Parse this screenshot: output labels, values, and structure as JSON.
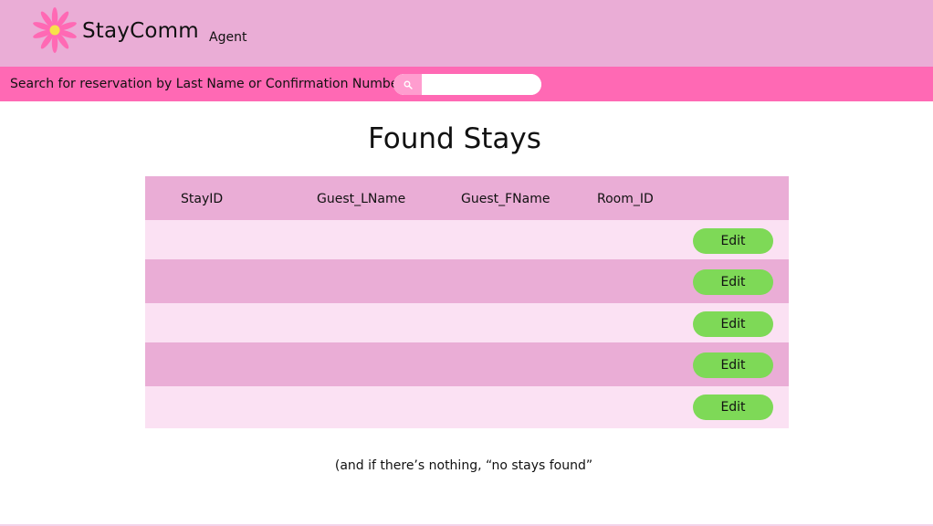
{
  "header": {
    "brand": "StayComm",
    "role": "Agent",
    "logo_icon": "pink-daisy-icon",
    "background": "#eaadd6"
  },
  "search": {
    "label": "Search for reservation by Last Name or Confirmation Number",
    "value": "",
    "placeholder": "",
    "icon": "search-icon",
    "bar_color": "#ff69b4"
  },
  "main": {
    "title": "Found Stays",
    "table": {
      "columns": [
        "StayID",
        "Guest_LName",
        "Guest_FName",
        "Room_ID"
      ],
      "rows": [
        {
          "stay_id": "",
          "guest_lname": "",
          "guest_fname": "",
          "room_id": "",
          "action": "Edit"
        },
        {
          "stay_id": "",
          "guest_lname": "",
          "guest_fname": "",
          "room_id": "",
          "action": "Edit"
        },
        {
          "stay_id": "",
          "guest_lname": "",
          "guest_fname": "",
          "room_id": "",
          "action": "Edit"
        },
        {
          "stay_id": "",
          "guest_lname": "",
          "guest_fname": "",
          "room_id": "",
          "action": "Edit"
        },
        {
          "stay_id": "",
          "guest_lname": "",
          "guest_fname": "",
          "room_id": "",
          "action": "Edit"
        }
      ],
      "header_color": "#eaadd6",
      "row_light_color": "#fbe1f3",
      "row_dark_color": "#eaadd6",
      "edit_color": "#7ed957"
    },
    "note": "(and if there’s nothing, “no stays found”"
  }
}
